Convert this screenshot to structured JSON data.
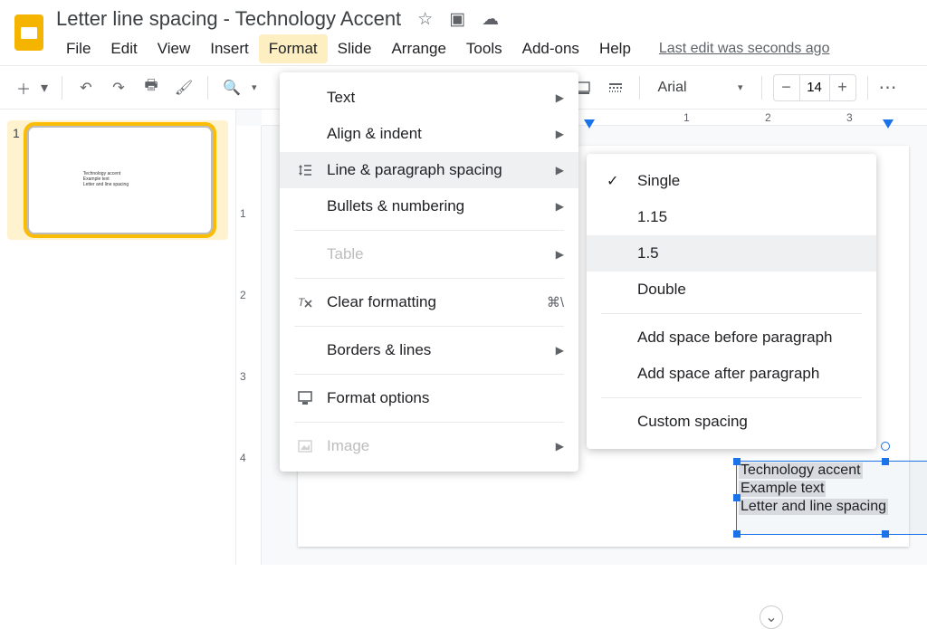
{
  "header": {
    "doc_title": "Letter line spacing - Technology Accent",
    "last_edit": "Last edit was seconds ago"
  },
  "menubar": {
    "items": [
      "File",
      "Edit",
      "View",
      "Insert",
      "Format",
      "Slide",
      "Arrange",
      "Tools",
      "Add-ons",
      "Help"
    ],
    "active_index": 4
  },
  "toolbar": {
    "font_name": "Arial",
    "font_size": "14"
  },
  "sidebar": {
    "slide_number": "1",
    "thumb_lines": [
      "Technology accent",
      "Example text",
      "Letter and line spacing"
    ]
  },
  "ruler": {
    "h_ticks": [
      "1",
      "2",
      "3"
    ],
    "v_ticks": [
      "1",
      "2",
      "3",
      "4"
    ]
  },
  "textbox": {
    "lines": [
      "Technology accent",
      "Example text",
      "Letter and line spacing"
    ]
  },
  "format_menu": {
    "items": [
      {
        "label": "Text",
        "arrow": true
      },
      {
        "label": "Align & indent",
        "arrow": true
      },
      {
        "label": "Line & paragraph spacing",
        "arrow": true,
        "highlight": true,
        "icon": "line-spacing"
      },
      {
        "label": "Bullets & numbering",
        "arrow": true
      },
      {
        "sep": true
      },
      {
        "label": "Table",
        "arrow": true,
        "disabled": true
      },
      {
        "sep": true
      },
      {
        "label": "Clear formatting",
        "shortcut": "⌘\\",
        "icon": "clear"
      },
      {
        "sep": true
      },
      {
        "label": "Borders & lines",
        "arrow": true
      },
      {
        "sep": true
      },
      {
        "label": "Format options",
        "icon": "format-options"
      },
      {
        "sep": true
      },
      {
        "label": "Image",
        "arrow": true,
        "disabled": true,
        "icon": "image"
      }
    ]
  },
  "spacing_submenu": {
    "items": [
      {
        "label": "Single",
        "checked": true
      },
      {
        "label": "1.15"
      },
      {
        "label": "1.5",
        "highlight": true
      },
      {
        "label": "Double"
      },
      {
        "sep": true
      },
      {
        "label": "Add space before paragraph"
      },
      {
        "label": "Add space after paragraph"
      },
      {
        "sep": true
      },
      {
        "label": "Custom spacing"
      }
    ]
  }
}
